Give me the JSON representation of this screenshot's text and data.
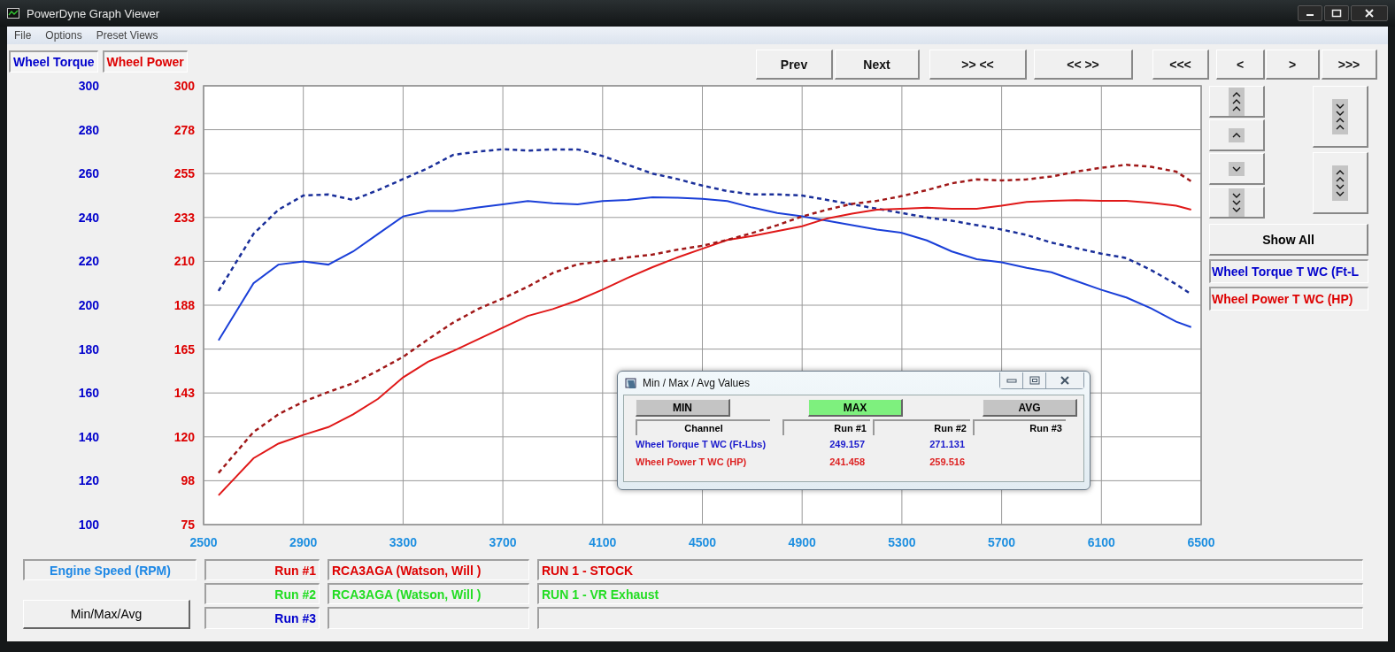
{
  "window": {
    "title": "PowerDyne Graph Viewer"
  },
  "menu": [
    "File",
    "Options",
    "Preset Views"
  ],
  "axis_tabs": [
    {
      "label": "Wheel Torque",
      "color": "#0000cc"
    },
    {
      "label": "Wheel Power",
      "color": "#dd0000"
    }
  ],
  "toolbar": [
    "Prev",
    "Next",
    ">> <<",
    "<< >>",
    "<<<",
    "<",
    ">",
    ">>>"
  ],
  "scale_buttons": [
    {
      "kind": "up3"
    },
    {
      "kind": "up1"
    },
    {
      "kind": "down1"
    },
    {
      "kind": "down3"
    }
  ],
  "zoom_buttons": [
    {
      "kind": "squeeze"
    },
    {
      "kind": "stretch"
    }
  ],
  "show_all": "Show All",
  "legend": [
    {
      "label": "Wheel Torque T WC (Ft-L",
      "color": "#0000cc"
    },
    {
      "label": "Wheel Power T WC (HP)",
      "color": "#dd0000"
    }
  ],
  "chart_data": {
    "type": "line",
    "grid": true,
    "x": [
      2560,
      2700,
      2800,
      2900,
      3000,
      3100,
      3200,
      3300,
      3400,
      3500,
      3600,
      3700,
      3800,
      3900,
      4000,
      4100,
      4200,
      4300,
      4400,
      4500,
      4600,
      4700,
      4800,
      4900,
      5000,
      5100,
      5200,
      5300,
      5400,
      5500,
      5600,
      5700,
      5800,
      5900,
      6000,
      6100,
      6200,
      6300,
      6400,
      6460
    ],
    "xlim": [
      2500,
      6500
    ],
    "xticks": [
      2500,
      2900,
      3300,
      3700,
      4100,
      4500,
      4900,
      5300,
      5700,
      6100,
      6500
    ],
    "ylim": [
      100,
      300
    ],
    "yticks": [
      100,
      120,
      140,
      160,
      180,
      200,
      220,
      240,
      260,
      280,
      300
    ],
    "y2lim": [
      75,
      300
    ],
    "y2ticks": [
      {
        "value": 75,
        "label": "75"
      },
      {
        "value": 97.5,
        "label": "98"
      },
      {
        "value": 120,
        "label": "120"
      },
      {
        "value": 142.5,
        "label": "143"
      },
      {
        "value": 165,
        "label": "165"
      },
      {
        "value": 187.5,
        "label": "188"
      },
      {
        "value": 210,
        "label": "210"
      },
      {
        "value": 232.5,
        "label": "233"
      },
      {
        "value": 255,
        "label": "255"
      },
      {
        "value": 277.5,
        "label": "278"
      },
      {
        "value": 300,
        "label": "300"
      }
    ],
    "series": [
      {
        "color": "#1a3fd8",
        "line_style": "solid",
        "values": [
          184,
          210,
          218.5,
          220,
          218.5,
          224.5,
          232.5,
          240.5,
          243,
          243,
          244.5,
          246,
          247.5,
          246.5,
          246,
          247.5,
          248,
          249.2,
          249,
          248.5,
          247.5,
          244.5,
          242,
          240.5,
          238.5,
          236.5,
          234.5,
          233,
          229.5,
          224.5,
          221,
          219.5,
          217,
          215,
          211,
          207,
          203.5,
          198.5,
          192.5,
          190
        ]
      },
      {
        "color": "#1a2f9a",
        "line_style": "dashed",
        "values": [
          206.5,
          232.5,
          243.5,
          250,
          250.5,
          248,
          252.5,
          257.5,
          262.5,
          268.5,
          270,
          271.1,
          270.5,
          271,
          271,
          268,
          264,
          260,
          257.5,
          254.5,
          252,
          250.5,
          250.5,
          250,
          248,
          246,
          244,
          242,
          240,
          238.5,
          236.5,
          234.5,
          232,
          228.5,
          226,
          223.5,
          221.5,
          216,
          209.5,
          205
        ]
      },
      {
        "color": "#e01818",
        "line_style": "solid",
        "axis": "y2",
        "values": [
          90,
          109,
          116.5,
          121,
          125,
          131.5,
          139.5,
          150.5,
          158.5,
          164,
          170,
          176,
          182,
          185.5,
          190,
          195.5,
          201.5,
          207,
          212,
          216.5,
          221,
          223,
          225.5,
          228,
          232,
          234.5,
          236.5,
          237,
          237.5,
          237,
          237,
          238.5,
          240.5,
          241,
          241.4,
          241,
          241,
          240,
          238.5,
          236.5
        ]
      },
      {
        "color": "#a01818",
        "line_style": "dashed",
        "axis": "y2",
        "values": [
          101.5,
          122.5,
          131.5,
          138,
          143,
          147.5,
          154,
          161,
          170,
          178.5,
          185.5,
          191,
          197,
          204,
          208.5,
          210,
          212,
          213.5,
          216,
          218,
          221,
          224.5,
          228.5,
          233,
          236.5,
          239.5,
          241,
          243.5,
          246.5,
          250,
          252,
          251.5,
          252,
          253.5,
          256,
          258,
          259.5,
          258.5,
          256,
          251
        ]
      }
    ]
  },
  "bottom": {
    "axis_label": "Engine Speed (RPM)",
    "minmax_button": "Min/Max/Avg",
    "runs": [
      {
        "label": "Run #1",
        "color": "#dd0000",
        "vehicle": "RCA3AGA (Watson, Will )",
        "description": "RUN 1 - STOCK"
      },
      {
        "label": "Run #2",
        "color": "#22dd22",
        "vehicle": "RCA3AGA (Watson, Will )",
        "description": "RUN 1 - VR Exhaust"
      },
      {
        "label": "Run #3",
        "color": "#0000cc"
      }
    ]
  },
  "dialog": {
    "title": "Min / Max / Avg Values",
    "modes": [
      {
        "label": "MIN",
        "selected": false
      },
      {
        "label": "MAX",
        "selected": true
      },
      {
        "label": "AVG",
        "selected": false
      }
    ],
    "columns": [
      "Channel",
      "Run #1",
      "Run #2",
      "Run #3"
    ],
    "rows": [
      {
        "channel": "Wheel Torque T WC (Ft-Lbs)",
        "color": "#1a1acc",
        "values": [
          "249.157",
          "271.131"
        ]
      },
      {
        "channel": "Wheel Power T WC (HP)",
        "color": "#dd2222",
        "values": [
          "241.458",
          "259.516"
        ]
      }
    ]
  }
}
